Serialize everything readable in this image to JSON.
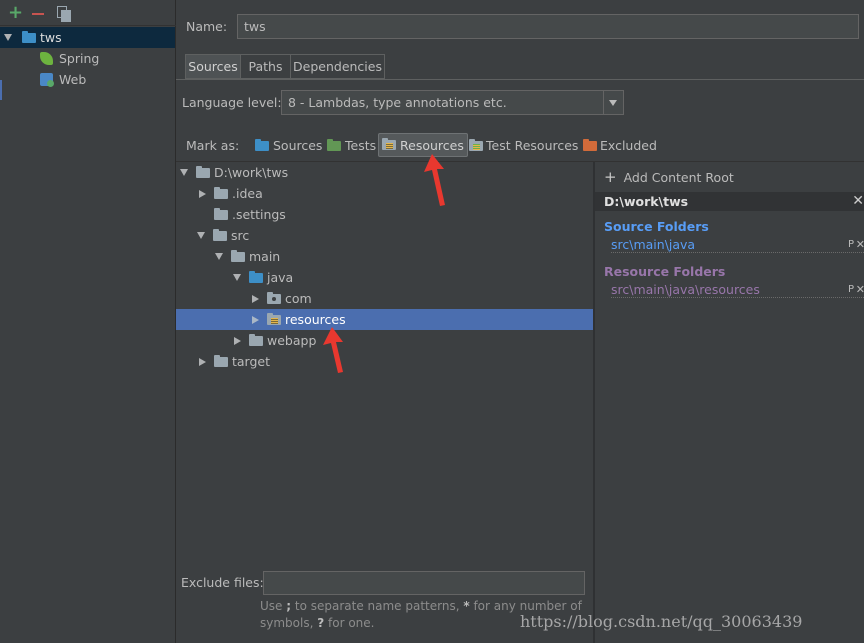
{
  "sidebar": {
    "tree": [
      {
        "label": "tws"
      },
      {
        "label": "Spring"
      },
      {
        "label": "Web"
      }
    ]
  },
  "name_field": {
    "label": "Name:",
    "value": "tws"
  },
  "tabs": [
    {
      "label": "Sources"
    },
    {
      "label": "Paths"
    },
    {
      "label": "Dependencies"
    }
  ],
  "language_level": {
    "label": "Language level:",
    "value": "8 - Lambdas, type annotations etc."
  },
  "mark_as": {
    "label": "Mark as:",
    "buttons": [
      {
        "label": "Sources"
      },
      {
        "label": "Tests"
      },
      {
        "label": "Resources"
      },
      {
        "label": "Test Resources"
      },
      {
        "label": "Excluded"
      }
    ]
  },
  "file_tree": [
    {
      "label": "D:\\work\\tws"
    },
    {
      "label": ".idea"
    },
    {
      "label": ".settings"
    },
    {
      "label": "src"
    },
    {
      "label": "main"
    },
    {
      "label": "java"
    },
    {
      "label": "com"
    },
    {
      "label": "resources"
    },
    {
      "label": "webapp"
    },
    {
      "label": "target"
    }
  ],
  "content_root": {
    "add_label": "Add Content Root",
    "path": "D:\\work\\tws",
    "source_folders_title": "Source Folders",
    "source_folder": "src\\main\\java",
    "resource_folders_title": "Resource Folders",
    "resource_folder": "src\\main\\java\\resources",
    "folder_props_label": "P"
  },
  "exclude": {
    "label": "Exclude files:",
    "value": "",
    "hint_prefix": "Use ",
    "hint_sep": ";",
    "hint_mid": " to separate name patterns, ",
    "hint_star": "*",
    "hint_mid2": " for any number of symbols, ",
    "hint_q": "?",
    "hint_end": " for one."
  },
  "watermark": "https://blog.csdn.net/qq_30063439",
  "colors": {
    "background": "#3c3f41",
    "selection": "#4b6eaf",
    "source_blue": "#589df6",
    "resource_purple": "#9876aa",
    "red_arrow": "#e8382f"
  }
}
